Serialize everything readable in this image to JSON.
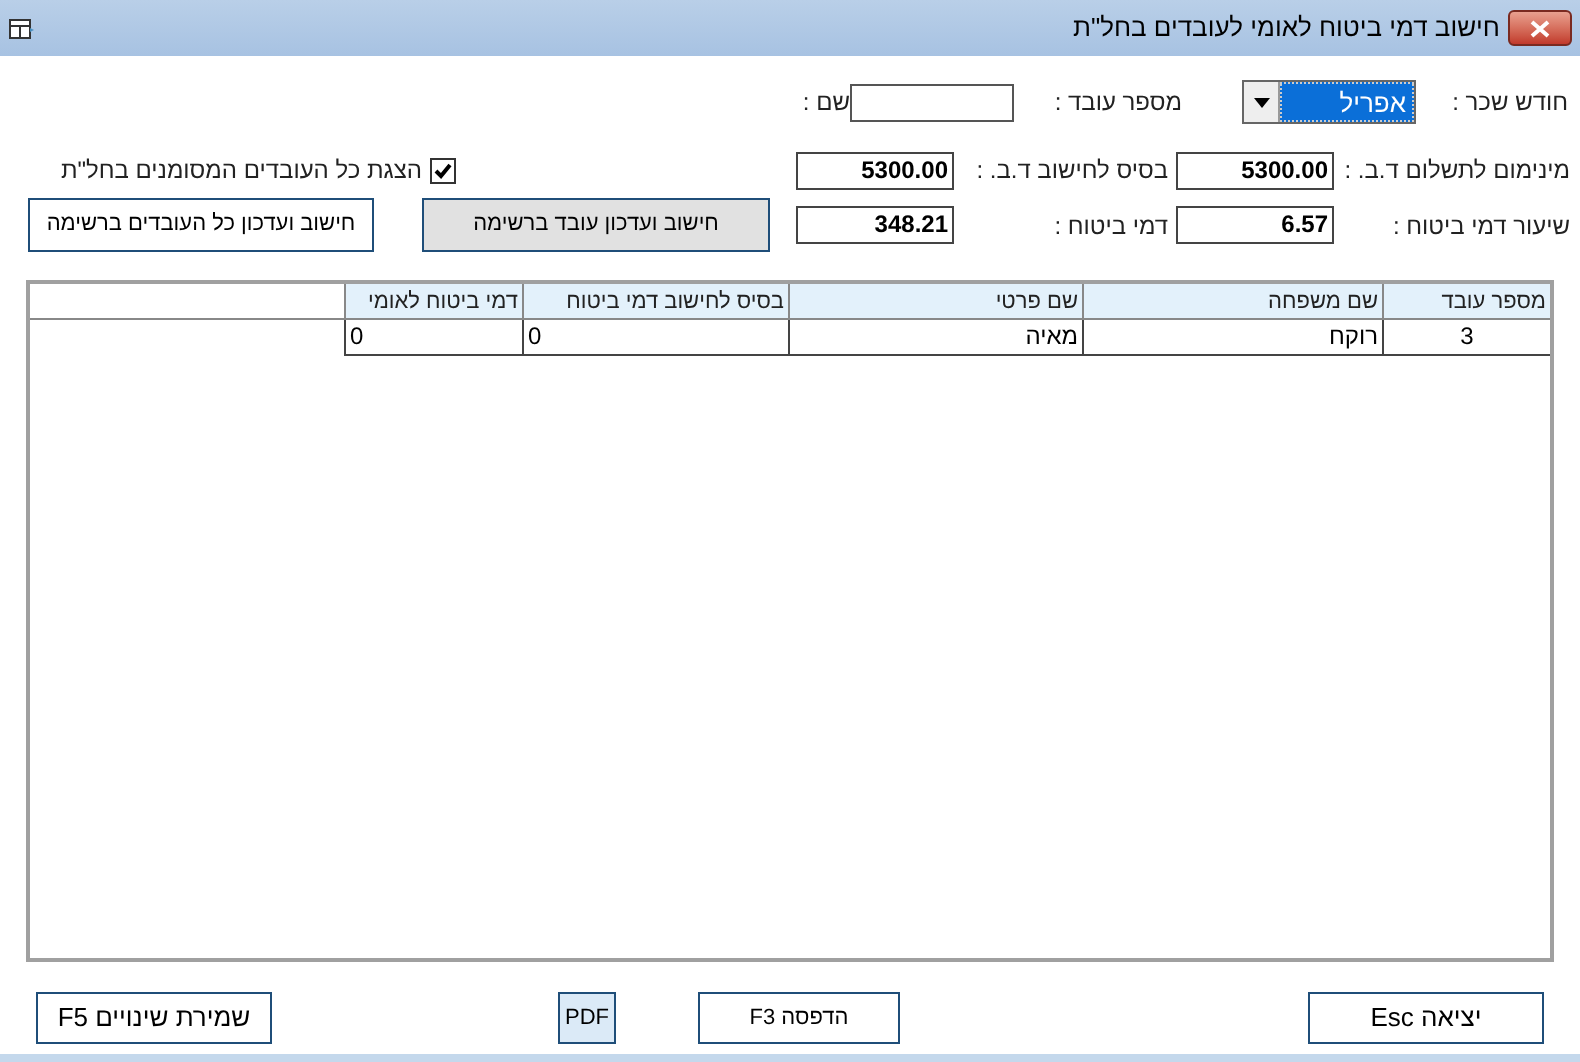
{
  "window": {
    "title": "חישוב דמי ביטוח לאומי לעובדים בחל\"ת"
  },
  "salary_month": {
    "label": "חודש שכר :",
    "value": "אפריל"
  },
  "employee_number": {
    "label": "מספר עובד :"
  },
  "name": {
    "label": "שם :"
  },
  "show_all": {
    "label": "הצגת כל העובדים המסומנים בחל\"ת",
    "checked": true
  },
  "minimum": {
    "label": "מינימום לתשלום ד.ב. :",
    "value": "5300.00"
  },
  "base": {
    "label": "בסיס לחישוב ד.ב. :",
    "value": "5300.00"
  },
  "rate": {
    "label": "שיעור דמי ביטוח :",
    "value": "6.57"
  },
  "premium": {
    "label": "דמי ביטוח :",
    "value": "348.21"
  },
  "calc_employee_button": "חישוב ועדכון עובד ברשימה",
  "calc_all_button": "חישוב ועדכון כל העובדים ברשימה",
  "table": {
    "columns": [
      "מספר עובד",
      "שם משפחה",
      "שם פרטי",
      "בסיס לחישוב דמי ביטוח",
      "דמי ביטוח לאומי"
    ],
    "rows": [
      [
        "3",
        "רוקח",
        "מאיה",
        "0",
        "0"
      ]
    ]
  },
  "buttons": {
    "exit": "יציאה Esc",
    "print": "הדפסה F3",
    "pdf": "PDF",
    "save": "שמירת שינויים F5"
  }
}
